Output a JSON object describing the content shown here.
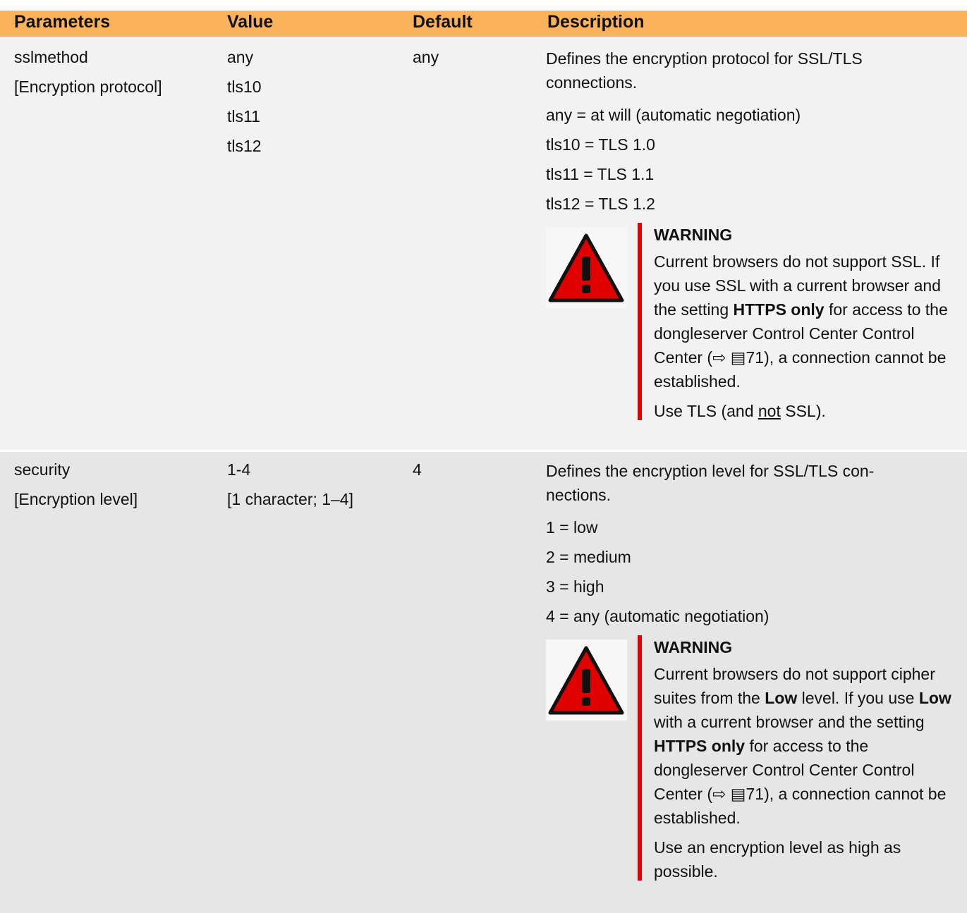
{
  "headers": [
    "Parameters",
    "Value",
    "Default",
    "Description"
  ],
  "rows": [
    {
      "param_name": "sslmethod",
      "param_label": "[Encryption protocol]",
      "values": [
        "any",
        "tls10",
        "tls11",
        "tls12"
      ],
      "default": "any",
      "description_intro": "Defines the encryption protocol for SSL/TLS connections.",
      "description_items": [
        "any = at will (automatic negotiation)",
        "tls10 = TLS 1.0",
        "tls11 = TLS 1.1",
        "tls12 = TLS 1.2"
      ],
      "warning": {
        "title": "WARNING",
        "t1": "Current browsers do not support SSL. If you use SSL with a current browser and the setting ",
        "t2": "HTTPS only",
        "t3": " for access to the  dongleserver Control Center Control Center (⇨ ",
        "t4": "▤",
        "t5": "71), a connection cannot be established.",
        "u1": "Use TLS (and ",
        "u2": "not",
        "u3": " SSL)."
      }
    },
    {
      "param_name": "security",
      "param_label": "[Encryption level]",
      "values": [
        "1-4",
        "[1 character; 1–4]"
      ],
      "default": "4",
      "description_intro_1": "Defines the encryption level for SSL/TLS con-",
      "description_intro_2": "nections.",
      "description_items": [
        "1 = low",
        "2 = medium",
        "3 = high",
        "4 = any (automatic negotiation)"
      ],
      "warning": {
        "title": "WARNING",
        "t1": "Current browsers do not support cipher suites from the ",
        "t2": "Low",
        "t3": " level. If you use ",
        "t4": "Low",
        "t5": " with a current browser and the setting ",
        "t6": "HTTPS only",
        "t7": " for access to the  dongleserver Control Center Control Center (⇨ ",
        "t8": "▤",
        "t9": "71), a connection cannot be established.",
        "u1": "Use an encryption level as high as possible."
      }
    }
  ],
  "colors": {
    "header": "#fbb35b",
    "row1": "#f2f2f2",
    "row2": "#e6e6e6",
    "warning_bar": "#e00000",
    "warning_icon": "#e00000"
  }
}
